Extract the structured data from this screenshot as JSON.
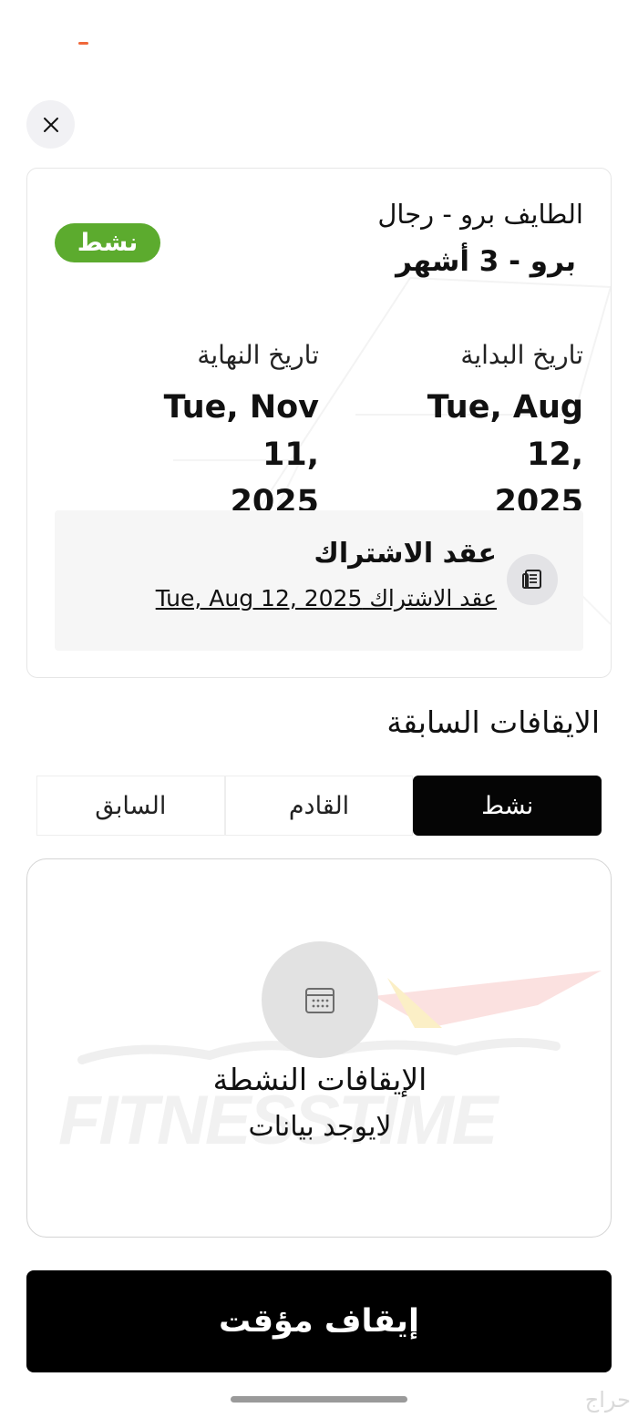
{
  "header": {
    "close_icon": "close-icon",
    "accent_color": "#f0683a"
  },
  "subscription": {
    "status": "نشط",
    "status_color": "#5cab2e",
    "club_name": "الطايف برو - رجال",
    "plan_name": "برو - 3 أشهر",
    "start_label": "تاريخ البداية",
    "start_date_line1": "Tue, Aug 12,",
    "start_date_line2": "2025",
    "end_label": "تاريخ النهاية",
    "end_date_line1": "Tue, Nov 11,",
    "end_date_line2": "2025",
    "contract": {
      "icon": "document-icon",
      "title": "عقد الاشتراك",
      "link_text": "عقد الاشتراك Tue, Aug 12, 2025"
    }
  },
  "freezes": {
    "section_title": "الايقافات السابقة",
    "tabs": [
      {
        "label": "نشط",
        "active": true
      },
      {
        "label": "القادم",
        "active": false
      },
      {
        "label": "السابق",
        "active": false
      }
    ],
    "empty_state": {
      "icon": "calendar-icon",
      "title": "الإيقافات النشطة",
      "subtitle": "لايوجد بيانات"
    }
  },
  "actions": {
    "pause_label": "إيقاف مؤقت"
  },
  "watermark": {
    "brand_text": "FITNESSTIME",
    "corner_mark": "حراج"
  }
}
